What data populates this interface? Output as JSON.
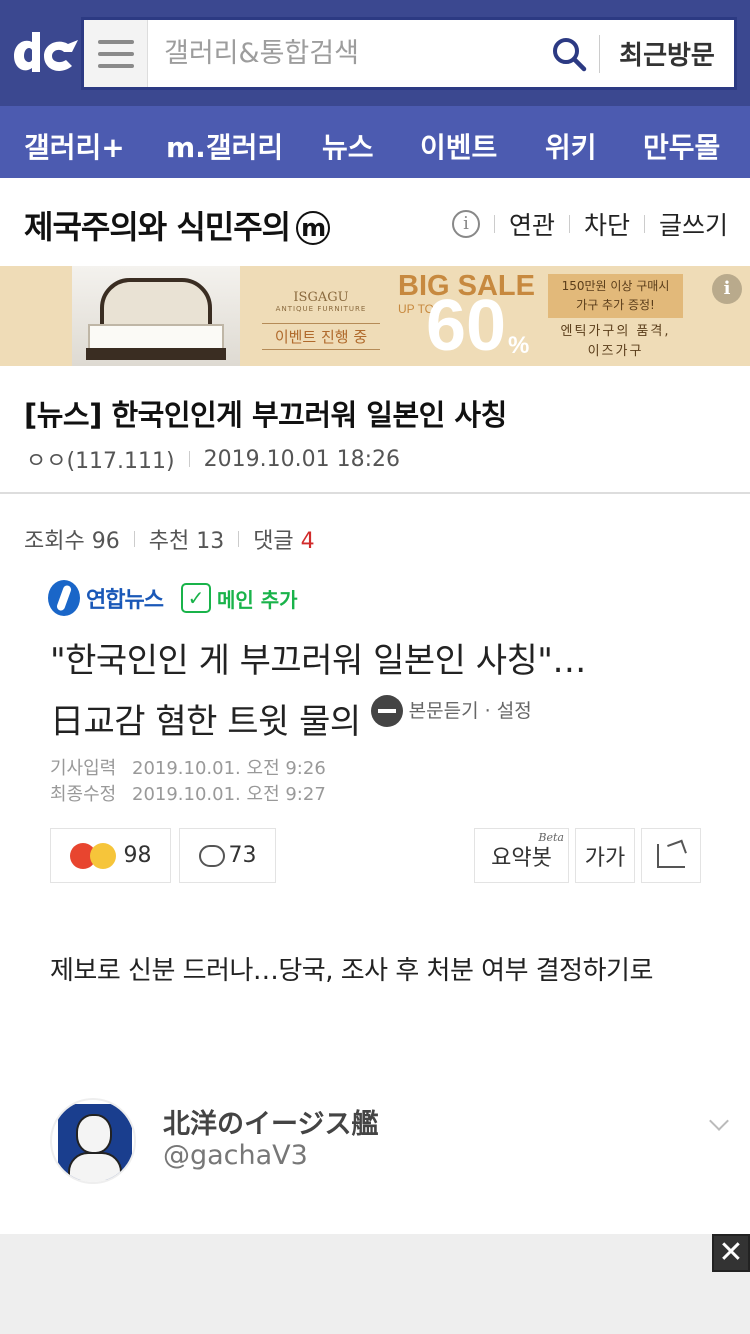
{
  "header": {
    "search_placeholder": "갤러리&통합검색",
    "recent_label": "최근방문"
  },
  "nav": {
    "items": [
      "갤러리+",
      "m.갤러리",
      "뉴스",
      "이벤트",
      "위키",
      "만두몰"
    ]
  },
  "gallery": {
    "title": "제국주의와 식민주의",
    "badge": "m",
    "actions": [
      "연관",
      "차단",
      "글쓰기"
    ]
  },
  "banner": {
    "brand": "ISGAGU",
    "brand_sub": "ANTIQUE FURNITURE",
    "event": "이벤트 진행 중",
    "big_sale": "BIG SALE",
    "up_to": "UP TO",
    "discount": "60",
    "percent": "%",
    "promo_line1": "150만원 이상 구매시",
    "promo_line2": "가구 추가 증정!",
    "tagline1": "엔틱가구의 품격,",
    "tagline2": "이즈가구"
  },
  "post": {
    "title": "[뉴스] 한국인인게 부끄러워 일본인 사칭",
    "author": "ㅇㅇ(117.111)",
    "datetime": "2019.10.01 18:26",
    "views_label": "조회수 96",
    "recommend_label": "추천 13",
    "comments_label": "댓글",
    "comments_count": "4"
  },
  "news": {
    "source": "연합뉴스",
    "main_add": "메인 추가",
    "headline_line1": "\"한국인인 게 부끄러워 일본인 사칭\"…",
    "headline_line2": "日교감 혐한 트윗 물의",
    "listen": "본문듣기 · 설정",
    "input_label": "기사입력",
    "input_date": "2019.10.01. 오전 9:26",
    "modified_label": "최종수정",
    "modified_date": "2019.10.01. 오전 9:27",
    "reactions": "98",
    "comment_count": "73",
    "summary_bot": "요약봇",
    "beta": "Beta",
    "font_size": "가가",
    "subhead": "제보로 신분 드러나…당국, 조사 후 처분 여부 결정하기로"
  },
  "tweet": {
    "name": "北洋のイージス艦",
    "handle": "@gachaV3"
  }
}
